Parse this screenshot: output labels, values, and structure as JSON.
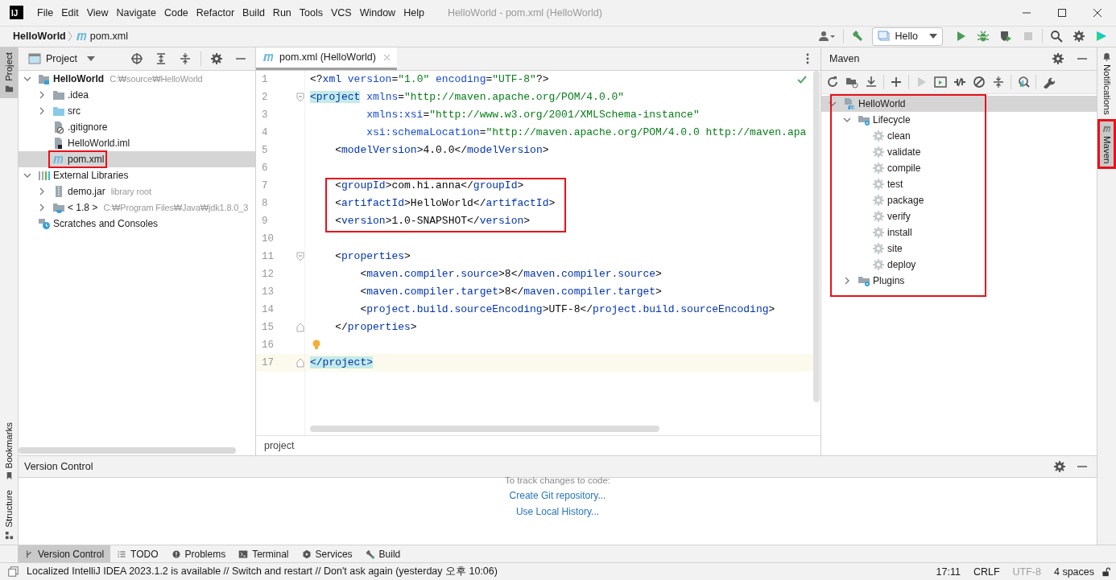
{
  "window": {
    "title": "HelloWorld - pom.xml (HelloWorld)",
    "logo": "IJ"
  },
  "menu": [
    "File",
    "Edit",
    "View",
    "Navigate",
    "Code",
    "Refactor",
    "Build",
    "Run",
    "Tools",
    "VCS",
    "Window",
    "Help"
  ],
  "navbar": {
    "crumbs": [
      {
        "label": "HelloWorld",
        "kind": "project"
      },
      {
        "label": "pom.xml",
        "kind": "maven-file"
      }
    ],
    "run_config": "Hello"
  },
  "left_stripe": {
    "top": [
      {
        "label": "Project",
        "kind": "folder",
        "selected": true
      }
    ],
    "bottom": [
      {
        "label": "Bookmarks",
        "kind": "bookmark",
        "selected": false
      },
      {
        "label": "Structure",
        "kind": "structure",
        "selected": false
      }
    ]
  },
  "project_panel": {
    "title": "Project",
    "tree": [
      {
        "label": "HelloWorld",
        "hint": "C:₩source₩HelloWorld",
        "kind": "project",
        "expanded": true,
        "selected": false,
        "highlighted": false,
        "children": [
          {
            "label": ".idea",
            "kind": "folder",
            "expanded": false,
            "selected": false,
            "highlighted": false
          },
          {
            "label": "src",
            "kind": "source-folder",
            "expanded": false,
            "selected": false,
            "highlighted": false
          },
          {
            "label": ".gitignore",
            "kind": "ignore-file",
            "selected": false,
            "highlighted": false
          },
          {
            "label": "HelloWorld.iml",
            "kind": "module-file",
            "selected": false,
            "highlighted": false
          },
          {
            "label": "pom.xml",
            "kind": "maven-file",
            "selected": true,
            "highlighted": true
          }
        ]
      },
      {
        "label": "External Libraries",
        "kind": "libraries",
        "expanded": true,
        "selected": false,
        "highlighted": false,
        "children": [
          {
            "label": "demo.jar",
            "hint": "library root",
            "kind": "jar",
            "expanded": false,
            "selected": false,
            "highlighted": false
          },
          {
            "label": "< 1.8 >",
            "hint": "C:₩Program Files₩Java₩jdk1.8.0_3",
            "kind": "jdk",
            "expanded": false,
            "selected": false,
            "highlighted": false
          }
        ]
      },
      {
        "label": "Scratches and Consoles",
        "kind": "scratches",
        "selected": false,
        "highlighted": false
      }
    ]
  },
  "editor": {
    "tabs": [
      {
        "label": "pom.xml (HelloWorld)",
        "selected": true
      }
    ],
    "breadcrumb": "project",
    "lines": [
      {
        "number": "1",
        "current": false,
        "highlighted": false,
        "kind": "plain",
        "segments": [
          {
            "kind": "plain",
            "text": "<?"
          },
          {
            "kind": "tag",
            "text": "xml"
          },
          {
            "kind": "attr",
            "text": " version"
          },
          {
            "kind": "plain",
            "text": "="
          },
          {
            "kind": "value",
            "text": "\"1.0\""
          },
          {
            "kind": "attr",
            "text": " encoding"
          },
          {
            "kind": "plain",
            "text": "="
          },
          {
            "kind": "value",
            "text": "\"UTF-8\""
          },
          {
            "kind": "plain",
            "text": "?>"
          }
        ]
      },
      {
        "number": "2",
        "current": false,
        "highlighted": false,
        "kind": "fold-start",
        "segments": [
          {
            "kind": "match",
            "text": "<project"
          },
          {
            "kind": "attr",
            "text": " xmlns"
          },
          {
            "kind": "plain",
            "text": "="
          },
          {
            "kind": "value",
            "text": "\"http://maven.apache.org/POM/4.0.0\""
          }
        ]
      },
      {
        "number": "3",
        "current": false,
        "highlighted": false,
        "kind": "plain",
        "segments": [
          {
            "kind": "attr",
            "text": "         xmlns:xsi"
          },
          {
            "kind": "plain",
            "text": "="
          },
          {
            "kind": "value",
            "text": "\"http://www.w3.org/2001/XMLSchema-instance\""
          }
        ]
      },
      {
        "number": "4",
        "current": false,
        "highlighted": false,
        "kind": "plain",
        "segments": [
          {
            "kind": "attr",
            "text": "         xsi:schemaLocation"
          },
          {
            "kind": "plain",
            "text": "="
          },
          {
            "kind": "value",
            "text": "\"http://maven.apache.org/POM/4.0.0 http://maven.apa"
          }
        ]
      },
      {
        "number": "5",
        "current": false,
        "highlighted": false,
        "kind": "plain",
        "segments": [
          {
            "kind": "plain",
            "text": "    <"
          },
          {
            "kind": "tag",
            "text": "modelVersion"
          },
          {
            "kind": "plain",
            "text": ">4.0.0</"
          },
          {
            "kind": "tag",
            "text": "modelVersion"
          },
          {
            "kind": "plain",
            "text": ">"
          }
        ]
      },
      {
        "number": "6",
        "current": false,
        "highlighted": false,
        "kind": "plain"
      },
      {
        "number": "7",
        "current": false,
        "highlighted": true,
        "kind": "plain",
        "segments": [
          {
            "kind": "plain",
            "text": "    <"
          },
          {
            "kind": "tag",
            "text": "groupId"
          },
          {
            "kind": "plain",
            "text": ">com.hi.anna</"
          },
          {
            "kind": "tag",
            "text": "groupId"
          },
          {
            "kind": "plain",
            "text": ">"
          }
        ]
      },
      {
        "number": "8",
        "current": false,
        "highlighted": true,
        "kind": "plain",
        "segments": [
          {
            "kind": "plain",
            "text": "    <"
          },
          {
            "kind": "tag",
            "text": "artifactId"
          },
          {
            "kind": "plain",
            "text": ">HelloWorld</"
          },
          {
            "kind": "tag",
            "text": "artifactId"
          },
          {
            "kind": "plain",
            "text": ">"
          }
        ]
      },
      {
        "number": "9",
        "current": false,
        "highlighted": true,
        "kind": "plain",
        "segments": [
          {
            "kind": "plain",
            "text": "    <"
          },
          {
            "kind": "tag",
            "text": "version"
          },
          {
            "kind": "plain",
            "text": ">1.0-SNAPSHOT</"
          },
          {
            "kind": "tag",
            "text": "version"
          },
          {
            "kind": "plain",
            "text": ">"
          }
        ]
      },
      {
        "number": "10",
        "current": false,
        "highlighted": false,
        "kind": "plain"
      },
      {
        "number": "11",
        "current": false,
        "highlighted": false,
        "kind": "fold-start",
        "segments": [
          {
            "kind": "plain",
            "text": "    <"
          },
          {
            "kind": "tag",
            "text": "properties"
          },
          {
            "kind": "plain",
            "text": ">"
          }
        ]
      },
      {
        "number": "12",
        "current": false,
        "highlighted": false,
        "kind": "plain",
        "segments": [
          {
            "kind": "plain",
            "text": "        <"
          },
          {
            "kind": "tag",
            "text": "maven.compiler.source"
          },
          {
            "kind": "plain",
            "text": ">8</"
          },
          {
            "kind": "tag",
            "text": "maven.compiler.source"
          },
          {
            "kind": "plain",
            "text": ">"
          }
        ]
      },
      {
        "number": "13",
        "current": false,
        "highlighted": false,
        "kind": "plain",
        "segments": [
          {
            "kind": "plain",
            "text": "        <"
          },
          {
            "kind": "tag",
            "text": "maven.compiler.target"
          },
          {
            "kind": "plain",
            "text": ">8</"
          },
          {
            "kind": "tag",
            "text": "maven.compiler.target"
          },
          {
            "kind": "plain",
            "text": ">"
          }
        ]
      },
      {
        "number": "14",
        "current": false,
        "highlighted": false,
        "kind": "plain",
        "segments": [
          {
            "kind": "plain",
            "text": "        <"
          },
          {
            "kind": "tag",
            "text": "project.build.sourceEncoding"
          },
          {
            "kind": "plain",
            "text": ">UTF-8</"
          },
          {
            "kind": "tag",
            "text": "project.build.sourceEncoding"
          },
          {
            "kind": "plain",
            "text": ">"
          }
        ]
      },
      {
        "number": "15",
        "current": false,
        "highlighted": false,
        "kind": "fold-end",
        "segments": [
          {
            "kind": "plain",
            "text": "    </"
          },
          {
            "kind": "tag",
            "text": "properties"
          },
          {
            "kind": "plain",
            "text": ">"
          }
        ]
      },
      {
        "number": "16",
        "current": false,
        "highlighted": false,
        "kind": "bulb"
      },
      {
        "number": "17",
        "current": true,
        "highlighted": false,
        "kind": "fold-end",
        "segments": [
          {
            "kind": "match",
            "text": "</project>"
          }
        ]
      }
    ]
  },
  "maven": {
    "title": "Maven",
    "highlighted": true,
    "tree": [
      {
        "label": "HelloWorld",
        "kind": "maven-project",
        "expanded": true,
        "selected": true,
        "children": [
          {
            "label": "Lifecycle",
            "kind": "lifecycle",
            "expanded": true,
            "selected": false,
            "children": [
              {
                "label": "clean",
                "kind": "goal",
                "selected": false
              },
              {
                "label": "validate",
                "kind": "goal",
                "selected": false
              },
              {
                "label": "compile",
                "kind": "goal",
                "selected": false
              },
              {
                "label": "test",
                "kind": "goal",
                "selected": false
              },
              {
                "label": "package",
                "kind": "goal",
                "selected": false
              },
              {
                "label": "verify",
                "kind": "goal",
                "selected": false
              },
              {
                "label": "install",
                "kind": "goal",
                "selected": false
              },
              {
                "label": "site",
                "kind": "goal",
                "selected": false
              },
              {
                "label": "deploy",
                "kind": "goal",
                "selected": false
              }
            ]
          },
          {
            "label": "Plugins",
            "kind": "lifecycle",
            "expanded": false,
            "selected": false
          }
        ]
      }
    ]
  },
  "right_stripe": [
    {
      "label": "Notifications",
      "kind": "bell",
      "selected": false,
      "highlighted": false
    },
    {
      "label": "Maven",
      "kind": "maven",
      "selected": true,
      "highlighted": true
    }
  ],
  "bottom_panel": {
    "title": "Version Control",
    "hint": "To track changes to code:",
    "links": [
      "Create Git repository...",
      "Use Local History..."
    ]
  },
  "tool_tabs": [
    {
      "label": "Version Control",
      "kind": "vcs",
      "selected": true
    },
    {
      "label": "TODO",
      "kind": "todo",
      "selected": false
    },
    {
      "label": "Problems",
      "kind": "problems",
      "selected": false
    },
    {
      "label": "Terminal",
      "kind": "terminal",
      "selected": false
    },
    {
      "label": "Services",
      "kind": "services",
      "selected": false
    },
    {
      "label": "Build",
      "kind": "build",
      "selected": false
    }
  ],
  "status_bar": {
    "message": "Localized IntelliJ IDEA 2023.1.2 is available // Switch and restart // Don't ask again (yesterday 오후 10:06)",
    "items": [
      {
        "label": "17:11",
        "disabled": false
      },
      {
        "label": "CRLF",
        "disabled": false
      },
      {
        "label": "UTF-8",
        "disabled": true
      },
      {
        "label": "4 spaces",
        "disabled": false
      }
    ]
  }
}
